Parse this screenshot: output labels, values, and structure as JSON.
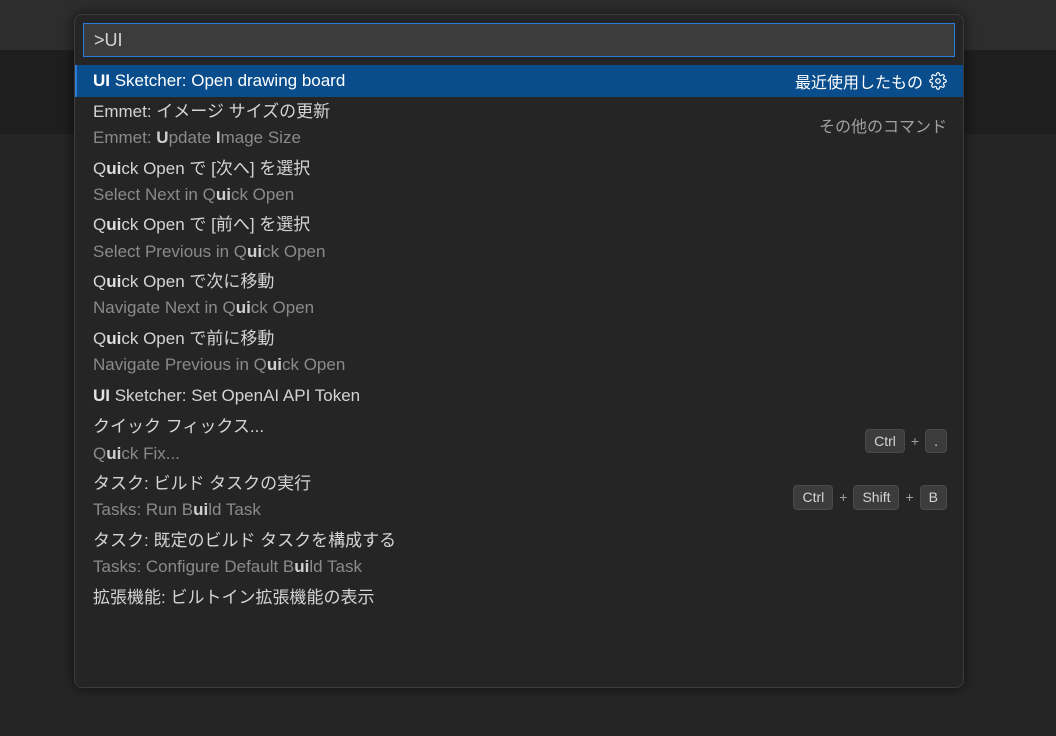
{
  "input": {
    "value": ">UI"
  },
  "groups": {
    "recent": "最近使用したもの",
    "other": "その他のコマンド"
  },
  "items": [
    {
      "primary_segments": [
        {
          "t": "UI",
          "hl": true
        },
        {
          "t": " Sketcher: Open drawing board",
          "hl": false
        }
      ],
      "secondary_segments": null,
      "group": "recent",
      "selected": true,
      "gear": true,
      "keys": null
    },
    {
      "primary_segments": [
        {
          "t": "Emmet: イメージ サイズの更新",
          "hl": false
        }
      ],
      "secondary_segments": [
        {
          "t": "Emmet: ",
          "hl": false
        },
        {
          "t": "U",
          "hl": true
        },
        {
          "t": "pdate ",
          "hl": false
        },
        {
          "t": "I",
          "hl": true
        },
        {
          "t": "mage Size",
          "hl": false
        }
      ],
      "group": "other",
      "selected": false,
      "gear": false,
      "keys": null
    },
    {
      "primary_segments": [
        {
          "t": "Q",
          "hl": false
        },
        {
          "t": "ui",
          "hl": true
        },
        {
          "t": "ck Open で [次へ] を選択",
          "hl": false
        }
      ],
      "secondary_segments": [
        {
          "t": "Select Next in Q",
          "hl": false
        },
        {
          "t": "ui",
          "hl": true
        },
        {
          "t": "ck Open",
          "hl": false
        }
      ],
      "group": null,
      "selected": false,
      "gear": false,
      "keys": null
    },
    {
      "primary_segments": [
        {
          "t": "Q",
          "hl": false
        },
        {
          "t": "ui",
          "hl": true
        },
        {
          "t": "ck Open で [前へ] を選択",
          "hl": false
        }
      ],
      "secondary_segments": [
        {
          "t": "Select Previous in Q",
          "hl": false
        },
        {
          "t": "ui",
          "hl": true
        },
        {
          "t": "ck Open",
          "hl": false
        }
      ],
      "group": null,
      "selected": false,
      "gear": false,
      "keys": null
    },
    {
      "primary_segments": [
        {
          "t": "Q",
          "hl": false
        },
        {
          "t": "ui",
          "hl": true
        },
        {
          "t": "ck Open で次に移動",
          "hl": false
        }
      ],
      "secondary_segments": [
        {
          "t": "Navigate Next in Q",
          "hl": false
        },
        {
          "t": "ui",
          "hl": true
        },
        {
          "t": "ck Open",
          "hl": false
        }
      ],
      "group": null,
      "selected": false,
      "gear": false,
      "keys": null
    },
    {
      "primary_segments": [
        {
          "t": "Q",
          "hl": false
        },
        {
          "t": "ui",
          "hl": true
        },
        {
          "t": "ck Open で前に移動",
          "hl": false
        }
      ],
      "secondary_segments": [
        {
          "t": "Navigate Previous in Q",
          "hl": false
        },
        {
          "t": "ui",
          "hl": true
        },
        {
          "t": "ck Open",
          "hl": false
        }
      ],
      "group": null,
      "selected": false,
      "gear": false,
      "keys": null
    },
    {
      "primary_segments": [
        {
          "t": "UI",
          "hl": true
        },
        {
          "t": " Sketcher: Set OpenAI API Token",
          "hl": false
        }
      ],
      "secondary_segments": null,
      "group": null,
      "selected": false,
      "gear": false,
      "keys": null
    },
    {
      "primary_segments": [
        {
          "t": "クイック フィックス...",
          "hl": false
        }
      ],
      "secondary_segments": [
        {
          "t": "Q",
          "hl": false
        },
        {
          "t": "ui",
          "hl": true
        },
        {
          "t": "ck Fix...",
          "hl": false
        }
      ],
      "group": null,
      "selected": false,
      "gear": false,
      "keys": [
        "Ctrl",
        "."
      ]
    },
    {
      "primary_segments": [
        {
          "t": "タスク: ビルド タスクの実行",
          "hl": false
        }
      ],
      "secondary_segments": [
        {
          "t": "Tasks: Run B",
          "hl": false
        },
        {
          "t": "ui",
          "hl": true
        },
        {
          "t": "ld Task",
          "hl": false
        }
      ],
      "group": null,
      "selected": false,
      "gear": false,
      "keys": [
        "Ctrl",
        "Shift",
        "B"
      ]
    },
    {
      "primary_segments": [
        {
          "t": "タスク: 既定のビルド タスクを構成する",
          "hl": false
        }
      ],
      "secondary_segments": [
        {
          "t": "Tasks: Configure Default B",
          "hl": false
        },
        {
          "t": "ui",
          "hl": true
        },
        {
          "t": "ld Task",
          "hl": false
        }
      ],
      "group": null,
      "selected": false,
      "gear": false,
      "keys": null
    },
    {
      "primary_segments": [
        {
          "t": "拡張機能: ビルトイン拡張機能の表示",
          "hl": false
        }
      ],
      "secondary_segments": null,
      "group": null,
      "selected": false,
      "gear": false,
      "keys": null
    }
  ]
}
